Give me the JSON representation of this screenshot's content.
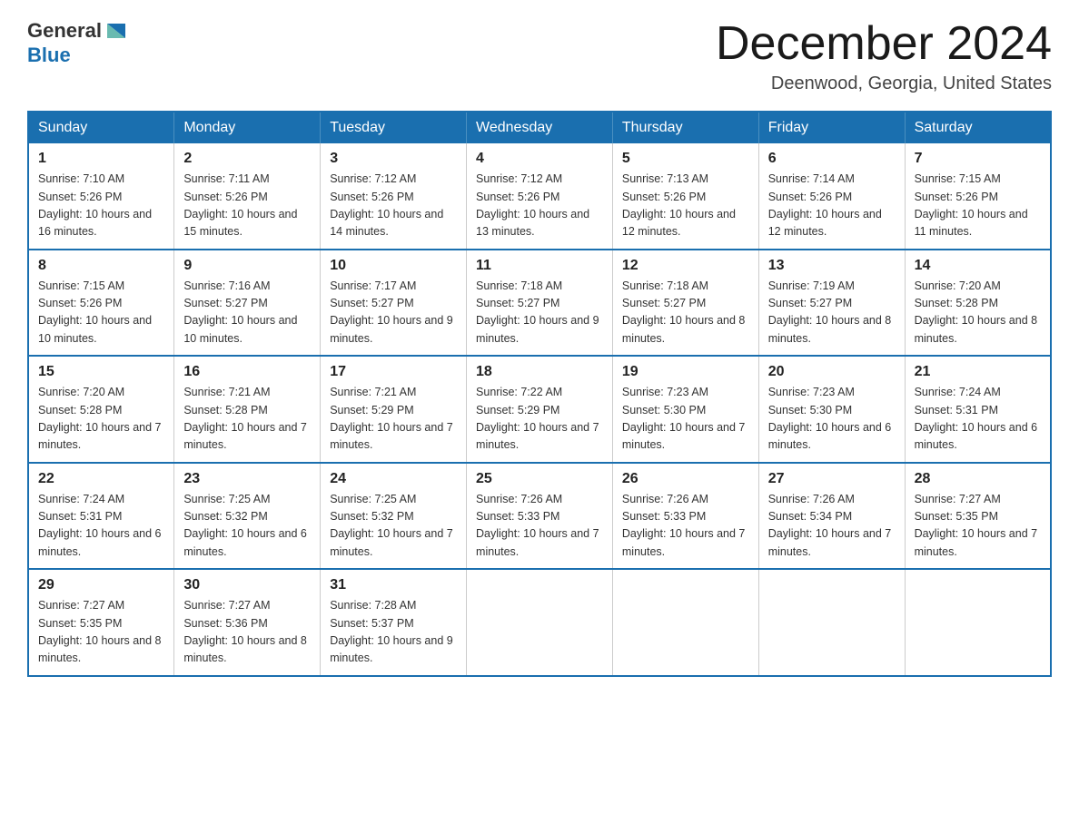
{
  "header": {
    "logo_general": "General",
    "logo_blue": "Blue",
    "title": "December 2024",
    "location": "Deenwood, Georgia, United States"
  },
  "calendar": {
    "days_of_week": [
      "Sunday",
      "Monday",
      "Tuesday",
      "Wednesday",
      "Thursday",
      "Friday",
      "Saturday"
    ],
    "weeks": [
      [
        {
          "day": "1",
          "sunrise": "7:10 AM",
          "sunset": "5:26 PM",
          "daylight": "10 hours and 16 minutes."
        },
        {
          "day": "2",
          "sunrise": "7:11 AM",
          "sunset": "5:26 PM",
          "daylight": "10 hours and 15 minutes."
        },
        {
          "day": "3",
          "sunrise": "7:12 AM",
          "sunset": "5:26 PM",
          "daylight": "10 hours and 14 minutes."
        },
        {
          "day": "4",
          "sunrise": "7:12 AM",
          "sunset": "5:26 PM",
          "daylight": "10 hours and 13 minutes."
        },
        {
          "day": "5",
          "sunrise": "7:13 AM",
          "sunset": "5:26 PM",
          "daylight": "10 hours and 12 minutes."
        },
        {
          "day": "6",
          "sunrise": "7:14 AM",
          "sunset": "5:26 PM",
          "daylight": "10 hours and 12 minutes."
        },
        {
          "day": "7",
          "sunrise": "7:15 AM",
          "sunset": "5:26 PM",
          "daylight": "10 hours and 11 minutes."
        }
      ],
      [
        {
          "day": "8",
          "sunrise": "7:15 AM",
          "sunset": "5:26 PM",
          "daylight": "10 hours and 10 minutes."
        },
        {
          "day": "9",
          "sunrise": "7:16 AM",
          "sunset": "5:27 PM",
          "daylight": "10 hours and 10 minutes."
        },
        {
          "day": "10",
          "sunrise": "7:17 AM",
          "sunset": "5:27 PM",
          "daylight": "10 hours and 9 minutes."
        },
        {
          "day": "11",
          "sunrise": "7:18 AM",
          "sunset": "5:27 PM",
          "daylight": "10 hours and 9 minutes."
        },
        {
          "day": "12",
          "sunrise": "7:18 AM",
          "sunset": "5:27 PM",
          "daylight": "10 hours and 8 minutes."
        },
        {
          "day": "13",
          "sunrise": "7:19 AM",
          "sunset": "5:27 PM",
          "daylight": "10 hours and 8 minutes."
        },
        {
          "day": "14",
          "sunrise": "7:20 AM",
          "sunset": "5:28 PM",
          "daylight": "10 hours and 8 minutes."
        }
      ],
      [
        {
          "day": "15",
          "sunrise": "7:20 AM",
          "sunset": "5:28 PM",
          "daylight": "10 hours and 7 minutes."
        },
        {
          "day": "16",
          "sunrise": "7:21 AM",
          "sunset": "5:28 PM",
          "daylight": "10 hours and 7 minutes."
        },
        {
          "day": "17",
          "sunrise": "7:21 AM",
          "sunset": "5:29 PM",
          "daylight": "10 hours and 7 minutes."
        },
        {
          "day": "18",
          "sunrise": "7:22 AM",
          "sunset": "5:29 PM",
          "daylight": "10 hours and 7 minutes."
        },
        {
          "day": "19",
          "sunrise": "7:23 AM",
          "sunset": "5:30 PM",
          "daylight": "10 hours and 7 minutes."
        },
        {
          "day": "20",
          "sunrise": "7:23 AM",
          "sunset": "5:30 PM",
          "daylight": "10 hours and 6 minutes."
        },
        {
          "day": "21",
          "sunrise": "7:24 AM",
          "sunset": "5:31 PM",
          "daylight": "10 hours and 6 minutes."
        }
      ],
      [
        {
          "day": "22",
          "sunrise": "7:24 AM",
          "sunset": "5:31 PM",
          "daylight": "10 hours and 6 minutes."
        },
        {
          "day": "23",
          "sunrise": "7:25 AM",
          "sunset": "5:32 PM",
          "daylight": "10 hours and 6 minutes."
        },
        {
          "day": "24",
          "sunrise": "7:25 AM",
          "sunset": "5:32 PM",
          "daylight": "10 hours and 7 minutes."
        },
        {
          "day": "25",
          "sunrise": "7:26 AM",
          "sunset": "5:33 PM",
          "daylight": "10 hours and 7 minutes."
        },
        {
          "day": "26",
          "sunrise": "7:26 AM",
          "sunset": "5:33 PM",
          "daylight": "10 hours and 7 minutes."
        },
        {
          "day": "27",
          "sunrise": "7:26 AM",
          "sunset": "5:34 PM",
          "daylight": "10 hours and 7 minutes."
        },
        {
          "day": "28",
          "sunrise": "7:27 AM",
          "sunset": "5:35 PM",
          "daylight": "10 hours and 7 minutes."
        }
      ],
      [
        {
          "day": "29",
          "sunrise": "7:27 AM",
          "sunset": "5:35 PM",
          "daylight": "10 hours and 8 minutes."
        },
        {
          "day": "30",
          "sunrise": "7:27 AM",
          "sunset": "5:36 PM",
          "daylight": "10 hours and 8 minutes."
        },
        {
          "day": "31",
          "sunrise": "7:28 AM",
          "sunset": "5:37 PM",
          "daylight": "10 hours and 9 minutes."
        },
        null,
        null,
        null,
        null
      ]
    ]
  }
}
